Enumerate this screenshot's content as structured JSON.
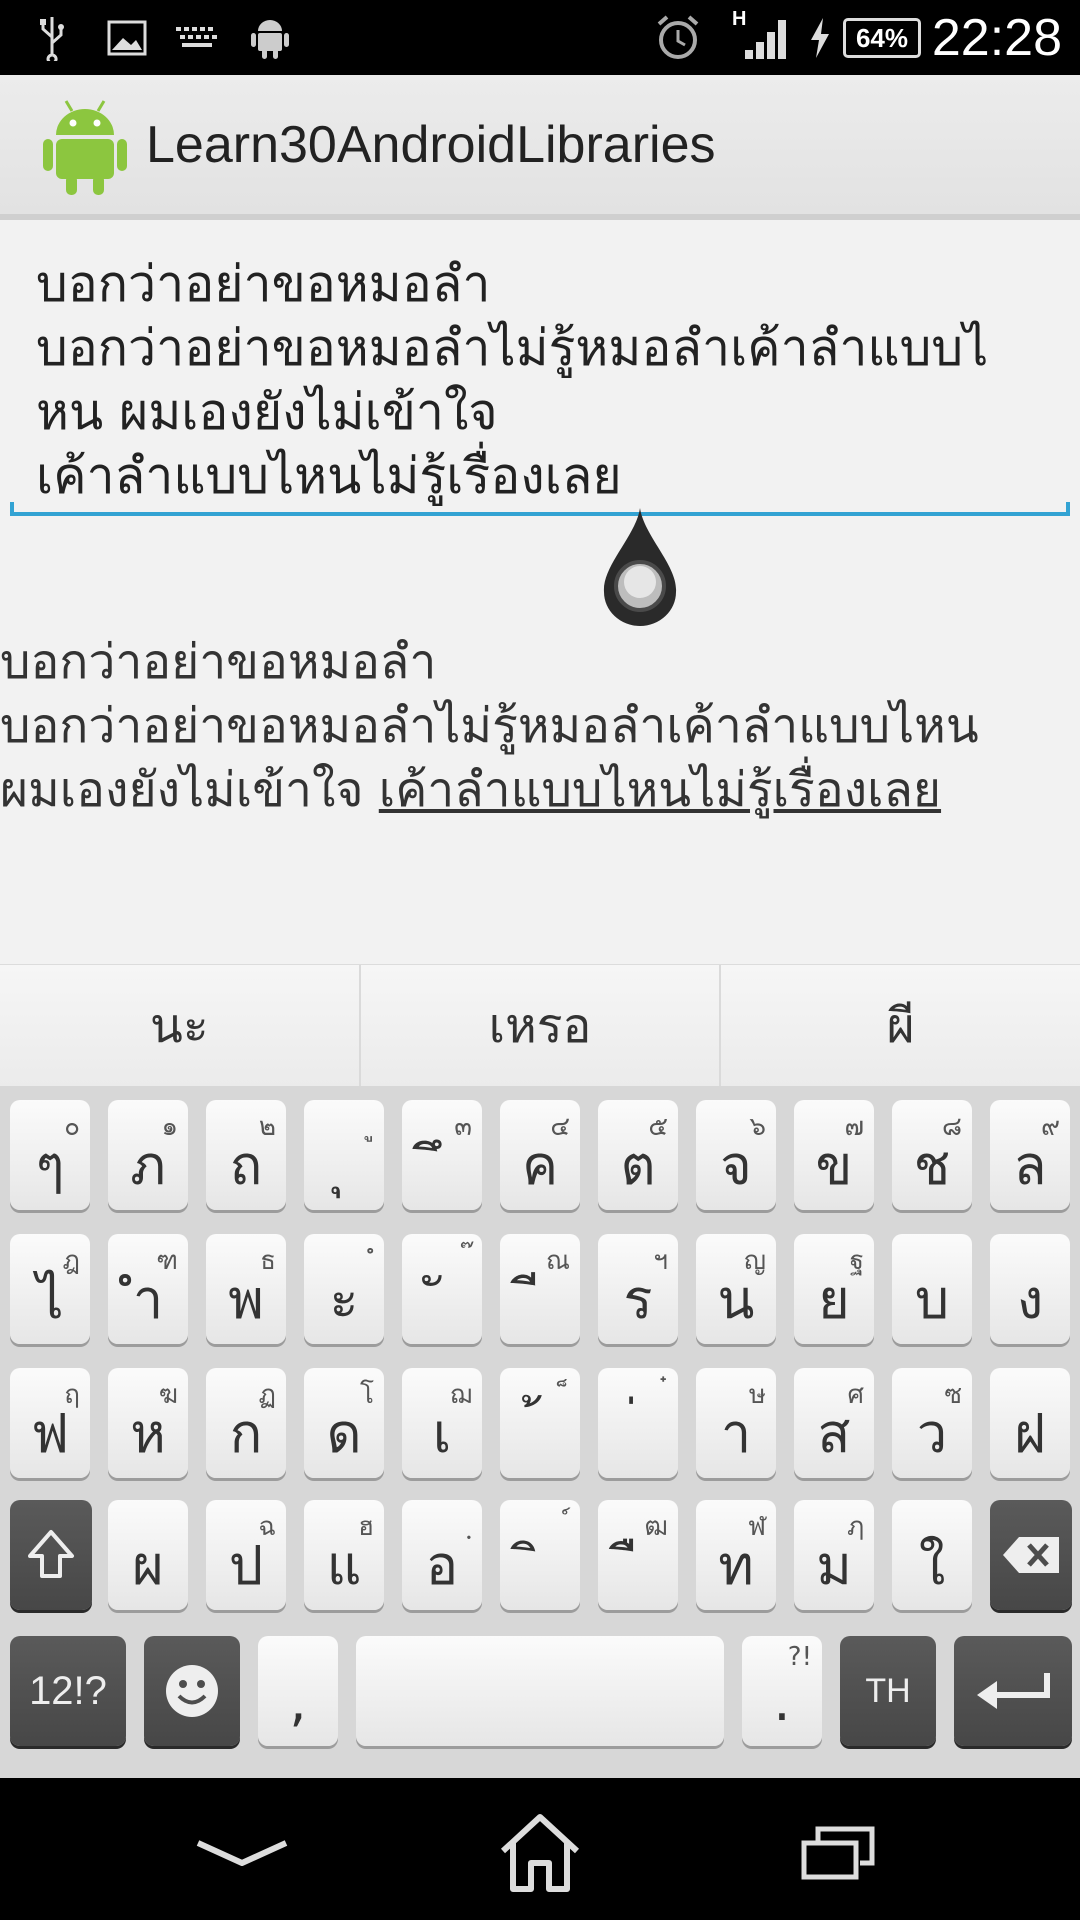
{
  "status_bar": {
    "time": "22:28",
    "battery_percent": "64%",
    "network_type": "H",
    "icons": [
      "usb-icon",
      "image-icon",
      "keyboard-icon",
      "android-icon",
      "alarm-icon",
      "signal-icon",
      "charging-icon",
      "battery-icon"
    ]
  },
  "action_bar": {
    "title": "Learn30AndroidLibraries",
    "icon": "android-robot-icon"
  },
  "edit_field": {
    "text": "บอกว่าอย่าขอหมอลำ\nบอกว่าอย่าขอหมอลำไม่รู้หมอลำเค้าลำแบบไ\nหน ผมเองยังไม่เข้าใจ\nเค้าลำแบบไหนไม่รู้เรื่องเลย"
  },
  "display_text": {
    "plain": "บอกว่าอย่าขอหมอลำ\nบอกว่าอย่าขอหมอลำไม่รู้หมอลำเค้าลำแบบไหน\nผมเองยังไม่เข้าใจ ",
    "link": "เค้าลำแบบไหนไม่รู้เรื่องเลย"
  },
  "suggestions": [
    "นะ",
    "เหรอ",
    "ผี"
  ],
  "keyboard": {
    "row1": [
      {
        "main": "ๆ",
        "sub": "๐"
      },
      {
        "main": "ภ",
        "sub": "๑"
      },
      {
        "main": "ถ",
        "sub": "๒"
      },
      {
        "main": "ุ",
        "sub": "ู"
      },
      {
        "main": "ึ",
        "sub": "๓"
      },
      {
        "main": "ค",
        "sub": "๔"
      },
      {
        "main": "ต",
        "sub": "๕"
      },
      {
        "main": "จ",
        "sub": "๖"
      },
      {
        "main": "ข",
        "sub": "๗"
      },
      {
        "main": "ช",
        "sub": "๘"
      },
      {
        "main": "ล",
        "sub": "๙"
      }
    ],
    "row2": [
      {
        "main": "ไ",
        "sub": "ฎ"
      },
      {
        "main": "ำ",
        "sub": "ฑ"
      },
      {
        "main": "พ",
        "sub": "ธ"
      },
      {
        "main": "ะ",
        "sub": "ํ"
      },
      {
        "main": "ั",
        "sub": "๊"
      },
      {
        "main": "ี",
        "sub": "ณ"
      },
      {
        "main": "ร",
        "sub": "ฯ"
      },
      {
        "main": "น",
        "sub": "ญ"
      },
      {
        "main": "ย",
        "sub": "ฐ"
      },
      {
        "main": "บ",
        "sub": ""
      },
      {
        "main": "ง",
        "sub": ""
      }
    ],
    "row3": [
      {
        "main": "ฟ",
        "sub": "ฤ"
      },
      {
        "main": "ห",
        "sub": "ฆ"
      },
      {
        "main": "ก",
        "sub": "ฏ"
      },
      {
        "main": "ด",
        "sub": "โ"
      },
      {
        "main": "เ",
        "sub": "ฌ"
      },
      {
        "main": "้",
        "sub": "็"
      },
      {
        "main": "่",
        "sub": "๋"
      },
      {
        "main": "า",
        "sub": "ษ"
      },
      {
        "main": "ส",
        "sub": "ศ"
      },
      {
        "main": "ว",
        "sub": "ซ"
      },
      {
        "main": "ฝ",
        "sub": ""
      }
    ],
    "row4": [
      {
        "main": "ผ",
        "sub": ""
      },
      {
        "main": "ป",
        "sub": "ฉ"
      },
      {
        "main": "แ",
        "sub": "ฮ"
      },
      {
        "main": "อ",
        "sub": "ฺ"
      },
      {
        "main": "ิ",
        "sub": "์"
      },
      {
        "main": "ื",
        "sub": "ฒ"
      },
      {
        "main": "ท",
        "sub": "ฬ"
      },
      {
        "main": "ม",
        "sub": "ฦ"
      },
      {
        "main": "ใ",
        "sub": ""
      }
    ],
    "symbols_label": "12!?",
    "comma_label": ",",
    "period_label": ".",
    "period_sub": "?!",
    "language_label": "TH"
  }
}
